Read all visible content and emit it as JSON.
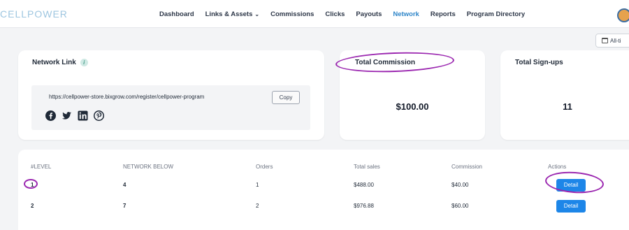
{
  "brand": {
    "logo_text": "CELLPOWER"
  },
  "nav": {
    "items": [
      {
        "label": "Dashboard",
        "active": false
      },
      {
        "label": "Links & Assets",
        "active": false,
        "has_dropdown": true
      },
      {
        "label": "Commissions",
        "active": false
      },
      {
        "label": "Clicks",
        "active": false
      },
      {
        "label": "Payouts",
        "active": false
      },
      {
        "label": "Network",
        "active": true
      },
      {
        "label": "Reports",
        "active": false
      },
      {
        "label": "Program Directory",
        "active": false
      }
    ],
    "active_color": "#2f86c9"
  },
  "date_filter": {
    "label": "All-ti"
  },
  "network_link": {
    "title": "Network Link",
    "url": "https://cellpower-store.bixgrow.com/register/cellpower-program",
    "copy_label": "Copy",
    "socials": [
      "facebook-icon",
      "twitter-icon",
      "linkedin-icon",
      "pinterest-icon"
    ]
  },
  "total_commission": {
    "title": "Total Commission",
    "value": "$100.00"
  },
  "total_signups": {
    "title": "Total Sign-ups",
    "value": "11"
  },
  "table": {
    "headers": [
      "#LEVEL",
      "NETWORK BELOW",
      "Orders",
      "Total sales",
      "Commission",
      "Actions"
    ],
    "rows": [
      {
        "level": "1",
        "network_below": "4",
        "orders": "1",
        "total_sales": "$488.00",
        "commission": "$40.00",
        "action": "Detail"
      },
      {
        "level": "2",
        "network_below": "7",
        "orders": "2",
        "total_sales": "$976.88",
        "commission": "$60.00",
        "action": "Detail"
      }
    ]
  },
  "colors": {
    "primary_button": "#1d86e8",
    "annotation": "#9b27b0",
    "background": "#f3f4f6"
  }
}
